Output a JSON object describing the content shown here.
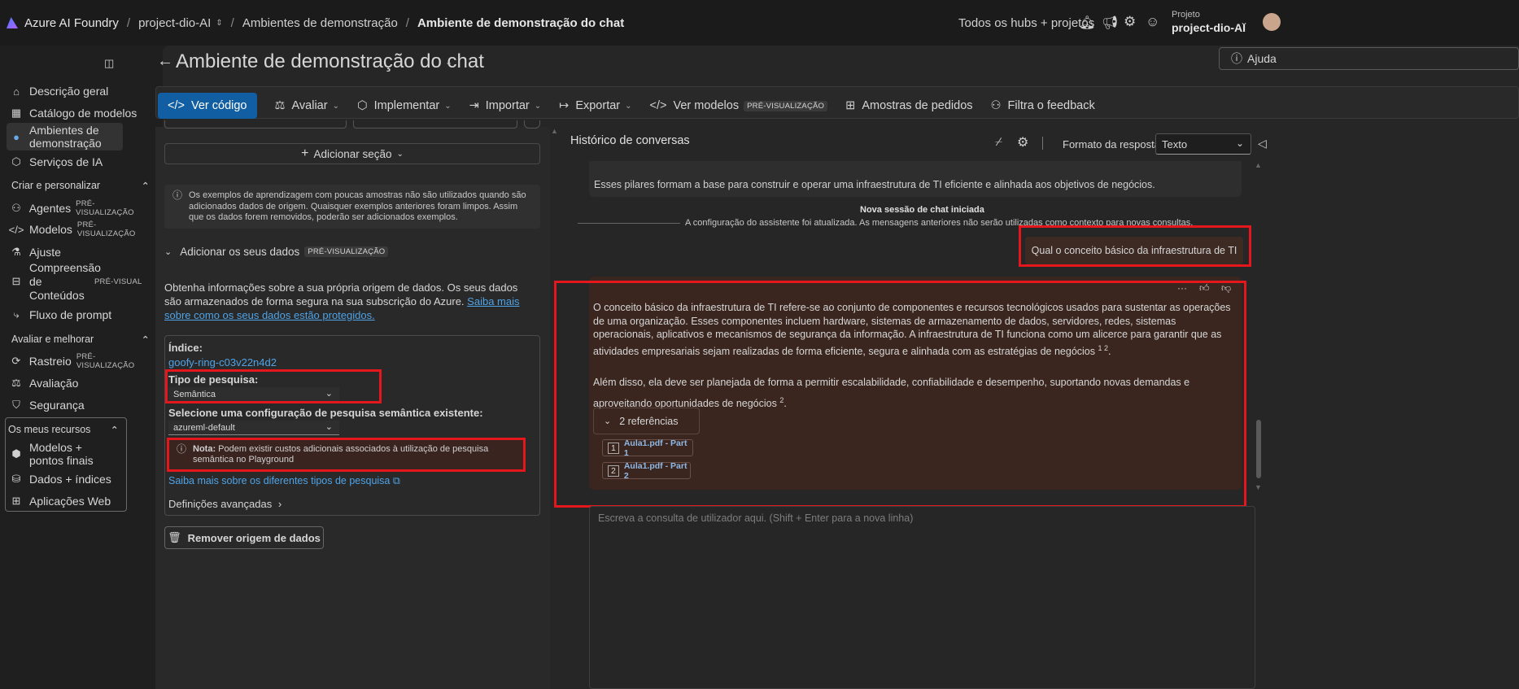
{
  "topbar": {
    "brand": "Azure AI Foundry",
    "project_crumb": "project-dio-AI",
    "crumb2": "Ambientes de demonstração",
    "crumb3": "Ambiente de demonstração do chat",
    "hubs_link": "Todos os hubs + projetos",
    "project_label": "Projeto",
    "project_name": "project-dio-AI"
  },
  "sidebar": {
    "items": [
      {
        "label": "Descrição geral"
      },
      {
        "label": "Catálogo de modelos"
      },
      {
        "label": "Ambientes de demonstração"
      },
      {
        "label": "Serviços de IA"
      }
    ],
    "group1": {
      "title": "Criar e personalizar",
      "items": [
        {
          "label": "Agentes",
          "badge": "PRÉ-VISUALIZAÇÃO"
        },
        {
          "label": "Modelos",
          "badge": "PRÉ-VISUALIZAÇÃO"
        },
        {
          "label": "Ajuste"
        },
        {
          "label": "Compreensão de Conteúdos",
          "badge": "PRÉ-VISUAL"
        },
        {
          "label": "Fluxo de prompt"
        }
      ]
    },
    "group2": {
      "title": "Avaliar e melhorar",
      "items": [
        {
          "label": "Rastreio",
          "badge": "PRÉ-VISUALIZAÇÃO"
        },
        {
          "label": "Avaliação"
        },
        {
          "label": "Segurança"
        }
      ]
    },
    "group3": {
      "title": "Os meus recursos",
      "items": [
        {
          "label": "Modelos + pontos finais"
        },
        {
          "label": "Dados + índices"
        },
        {
          "label": "Aplicações Web"
        }
      ]
    }
  },
  "page": {
    "title": "Ambiente de demonstração do chat",
    "help": "Ajuda"
  },
  "toolbar": {
    "view_code": "Ver código",
    "evaluate": "Avaliar",
    "deploy": "Implementar",
    "import": "Importar",
    "export": "Exportar",
    "view_models": "Ver modelos",
    "preview_badge": "PRÉ-VISUALIZAÇÃO",
    "samples": "Amostras de pedidos",
    "feedback": "Filtra o feedback"
  },
  "left": {
    "add_section": "Adicionar seção",
    "info_text": "Os exemplos de aprendizagem com poucas amostras não são utilizados quando são adicionados dados de origem. Quaisquer exemplos anteriores foram limpos. Assim que os dados forem removidos, poderão ser adicionados exemplos.",
    "add_data_title": "Adicionar os seus dados",
    "add_data_badge": "PRÉ-VISUALIZAÇÃO",
    "desc_text": "Obtenha informações sobre a sua própria origem de dados. Os seus dados são armazenados de forma segura na sua subscrição do Azure.",
    "desc_link": "Saiba mais sobre como os seus dados estão protegidos.",
    "index_label": "Índice:",
    "index_value": "goofy-ring-c03v22n4d2",
    "search_type_label": "Tipo de pesquisa:",
    "search_type_value": "Semântica",
    "semantic_config_label": "Selecione uma configuração de pesquisa semântica existente:",
    "semantic_config_value": "azureml-default",
    "note_bold": "Nota:",
    "note_text": "Podem existir custos adicionais associados à utilização de pesquisa semântica no Playground",
    "learn_more": "Saiba mais sobre os diferentes tipos de pesquisa",
    "advanced": "Definições avançadas",
    "remove_source": "Remover origem de dados"
  },
  "right": {
    "history_title": "Histórico de conversas",
    "response_format_label": "Formato da resposta",
    "response_format_value": "Texto",
    "prev_message": "Esses pilares formam a base para construir e operar uma infraestrutura de TI eficiente e alinhada aos objetivos de negócios.",
    "new_session": "Nova sessão de chat iniciada",
    "config_updated": "A configuração do assistente foi atualizada. As mensagens anteriores não serão utilizadas como contexto para novas consultas.",
    "user_message": "Qual o conceito básico da infraestrutura de TI",
    "answer_p1": "O conceito básico da infraestrutura de TI refere-se ao conjunto de componentes e recursos tecnológicos usados para sustentar as operações de uma organização. Esses componentes incluem hardware, sistemas de armazenamento de dados, servidores, redes, sistemas operacionais, aplicativos e mecanismos de segurança da informação. A infraestrutura de TI funciona como um alicerce para garantir que as atividades empresariais sejam realizadas de forma eficiente, segura e alinhada com as estratégias de negócios",
    "answer_p1_refs": "1 2",
    "answer_p2": "Além disso, ela deve ser planejada de forma a permitir escalabilidade, confiabilidade e desempenho, suportando novas demandas e aproveitando oportunidades de negócios",
    "answer_p2_refs": "2",
    "refs_toggle": "2 referências",
    "refs": [
      {
        "num": "1",
        "label": "Aula1.pdf - Part 1"
      },
      {
        "num": "2",
        "label": "Aula1.pdf - Part 2"
      }
    ],
    "input_placeholder": "Escreva a consulta de utilizador aqui. (Shift + Enter para a nova linha)"
  }
}
